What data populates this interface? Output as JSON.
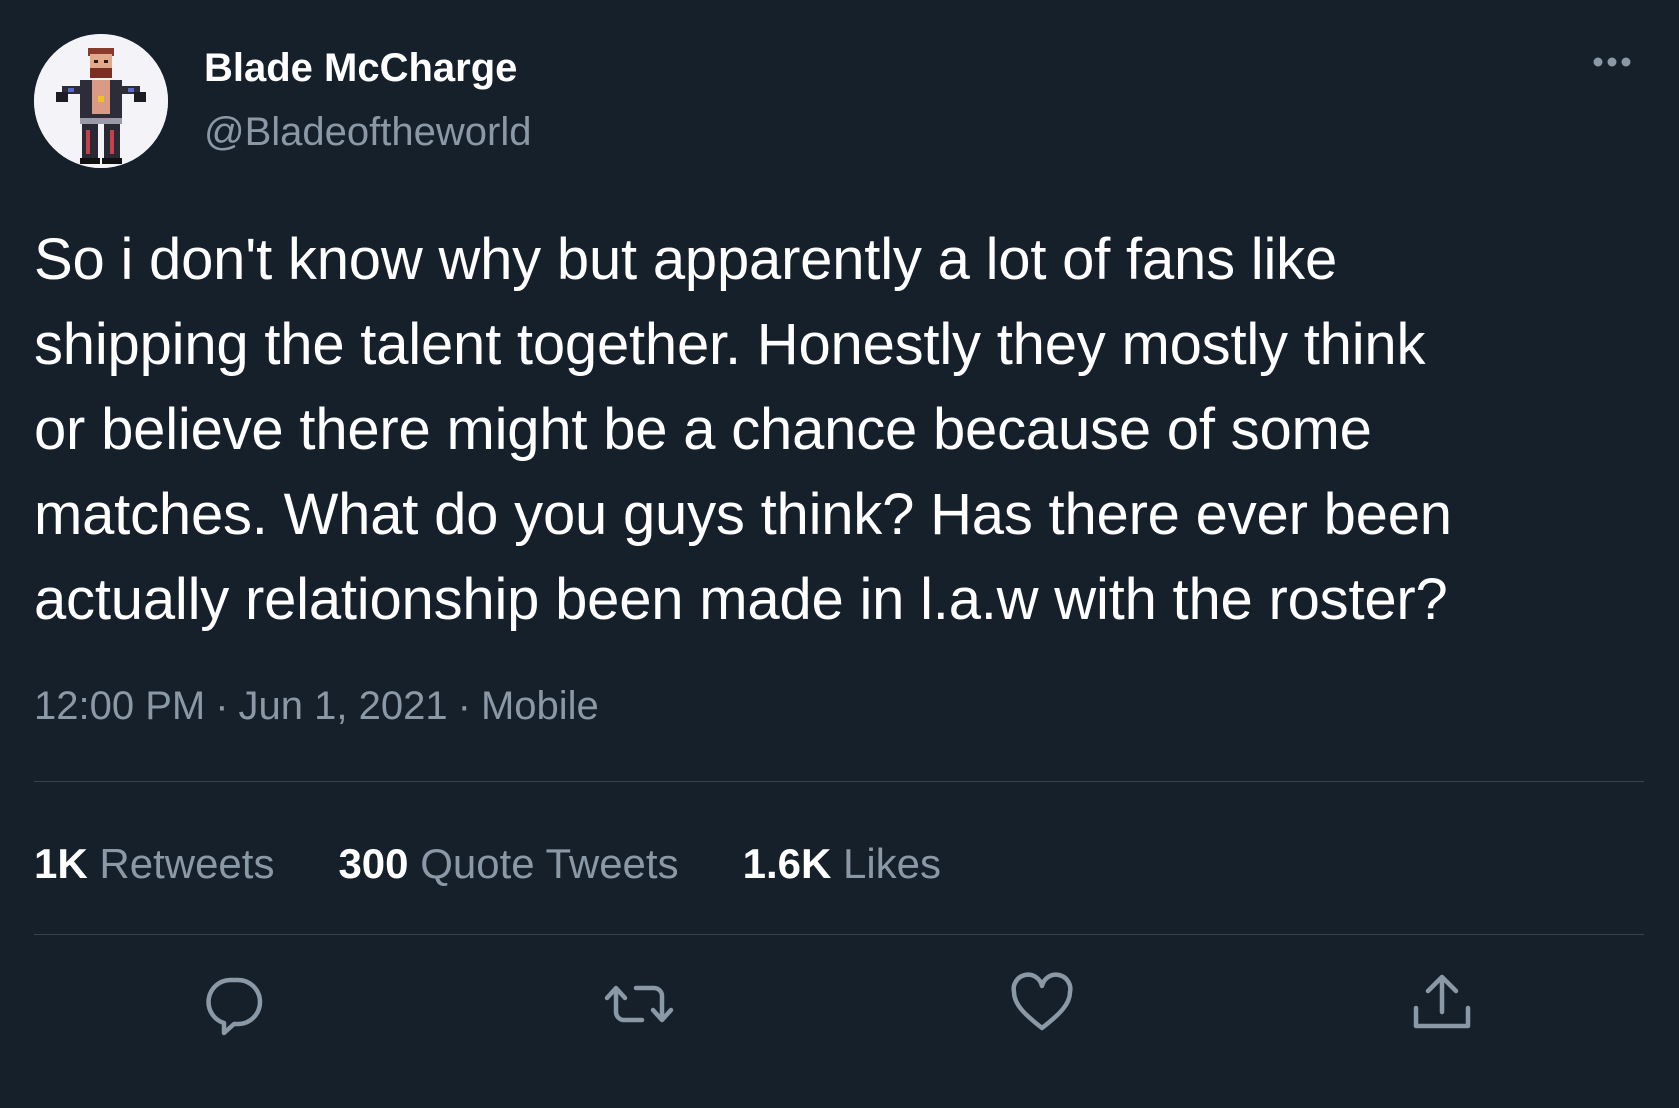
{
  "author": {
    "display_name": "Blade McCharge",
    "handle": "@Bladeoftheworld",
    "avatar_icon": "wrestler-avatar-icon"
  },
  "tweet": {
    "text_lines": [
      "So i don't know why but apparently a lot of fans like",
      "shipping the talent together. Honestly they mostly think",
      "or believe there might be a chance because of some",
      "matches. What do you guys think? Has there ever been",
      "actually relationship been made in l.a.w with the roster?"
    ],
    "time": "12:00 PM",
    "date": "Jun 1, 2021",
    "source": "Mobile",
    "separator": "·"
  },
  "stats": {
    "retweets": {
      "count": "1K",
      "label": "Retweets"
    },
    "quote_tweets": {
      "count": "300",
      "label": "Quote Tweets"
    },
    "likes": {
      "count": "1.6K",
      "label": "Likes"
    }
  },
  "actions": {
    "reply_icon": "reply-icon",
    "retweet_icon": "retweet-icon",
    "like_icon": "heart-icon",
    "share_icon": "share-icon",
    "more_icon": "more-options-icon"
  },
  "colors": {
    "background": "#15202b",
    "primary_text": "#ffffff",
    "secondary_text": "#8b98a5",
    "divider": "#38444d"
  }
}
